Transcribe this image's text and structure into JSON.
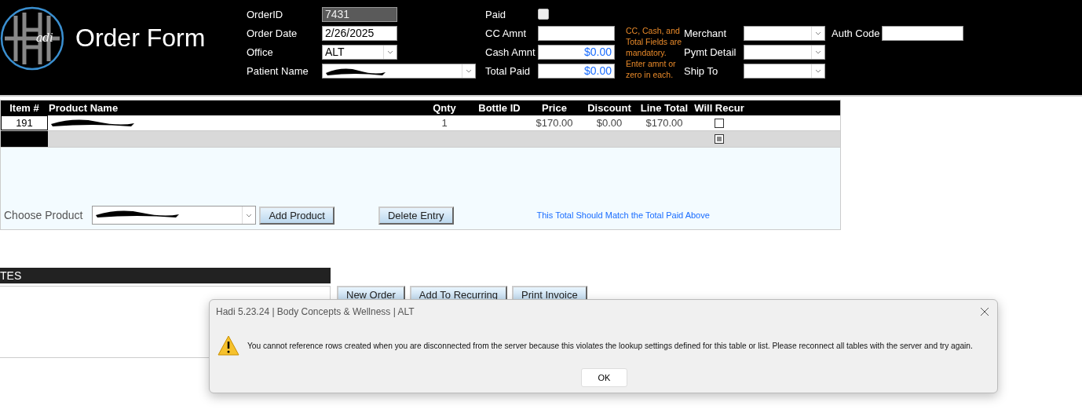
{
  "header": {
    "logo_text": "adi",
    "title": "Order Form",
    "fields": [
      {
        "label": "OrderID",
        "value": "7431",
        "kind": "locked"
      },
      {
        "label": "Order Date",
        "value": "2/26/2025",
        "kind": "text"
      },
      {
        "label": "Office",
        "value": "ALT",
        "kind": "select"
      },
      {
        "label": "Patient Name",
        "kind": "redacted-select"
      }
    ],
    "paid": {
      "label": "Paid",
      "checked": false
    },
    "amounts": [
      {
        "label": "CC Amnt"
      },
      {
        "label": "Cash Amnt",
        "value": "$0.00"
      },
      {
        "label": "Total Paid",
        "value": "$0.00"
      }
    ],
    "note": "CC, Cash, and Total Fields are mandatory. Enter amnt or zero in each.",
    "payment": [
      {
        "label": "Merchant"
      },
      {
        "label": "Pymt Detail"
      },
      {
        "label": "Ship To"
      }
    ],
    "auth_code": {
      "label": "Auth Code"
    }
  },
  "table": {
    "columns": [
      "Item #",
      "Product Name",
      "Qnty",
      "Bottle ID",
      "Price",
      "Discount",
      "Line Total",
      "Will Recur"
    ],
    "rows": [
      {
        "kind": "record",
        "item": "191",
        "qnty": "1",
        "price": "$170.00",
        "discount": "$0.00",
        "line_total": "$170.00",
        "will_recur": false
      },
      {
        "kind": "new",
        "will_recur": true
      }
    ],
    "choose_label": "Choose Product",
    "buttons": [
      "Add Product",
      "Delete Entry"
    ],
    "total_hint": "This Total Should Match the Total Paid Above"
  },
  "notes": {
    "title": "TES"
  },
  "actions": [
    "New Order",
    "Add To Recurring",
    "Print Invoice"
  ],
  "dialog": {
    "title": "Hadi 5.23.24 | Body Concepts & Wellness | ALT",
    "message": "You cannot reference rows created when you are disconnected from the server because this violates the lookup settings defined for this table or list. Please reconnect all tables with the server and try again.",
    "button": "OK"
  }
}
